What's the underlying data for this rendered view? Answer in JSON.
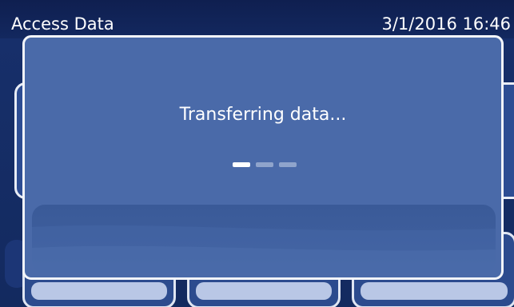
{
  "header": {
    "title": "Access Data",
    "datetime": "3/1/2016 16:46"
  },
  "dialog": {
    "message": "Transferring data...",
    "progress": {
      "segments": 3,
      "active_segment": 1
    }
  },
  "colors": {
    "title_bar": "#0f1f50",
    "dialog_bg": "#4a6aa9",
    "dialog_border": "#f3f5fa",
    "progress_active": "#ffffff",
    "progress_inactive": "#8fa4cc"
  }
}
